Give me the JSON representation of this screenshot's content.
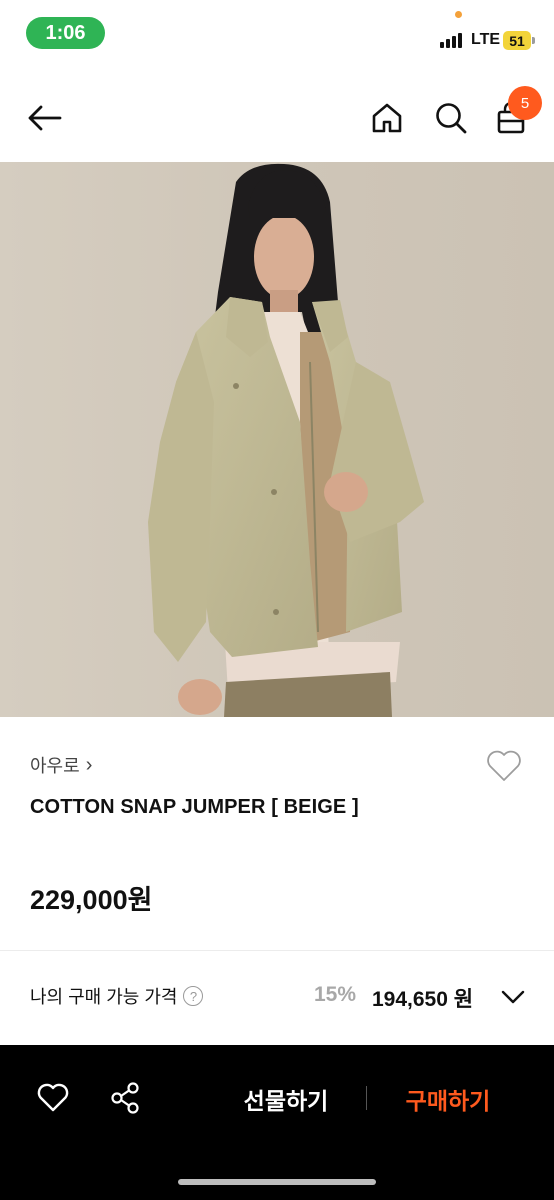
{
  "status_bar": {
    "time": "1:06",
    "network": "LTE",
    "battery": "51"
  },
  "header": {
    "back_icon": "arrow-left-icon",
    "home_icon": "home-icon",
    "search_icon": "search-icon",
    "cart_icon": "shopping-bag-icon",
    "cart_count": "5"
  },
  "product": {
    "image_subject": "model-wearing-beige-jacket",
    "brand": "아우로",
    "brand_chevron": "›",
    "name": "COTTON SNAP JUMPER [ BEIGE ]",
    "price": "229,000원"
  },
  "my_price": {
    "label": "나의 구매 가능 가격",
    "help": "?",
    "discount": "15%",
    "price": "194,650 원"
  },
  "bottom_bar": {
    "gift_label": "선물하기",
    "buy_label": "구매하기"
  },
  "colors": {
    "accent": "#ff5a1e",
    "status_green": "#2fb455",
    "bottom_bar_bg": "#000000"
  }
}
